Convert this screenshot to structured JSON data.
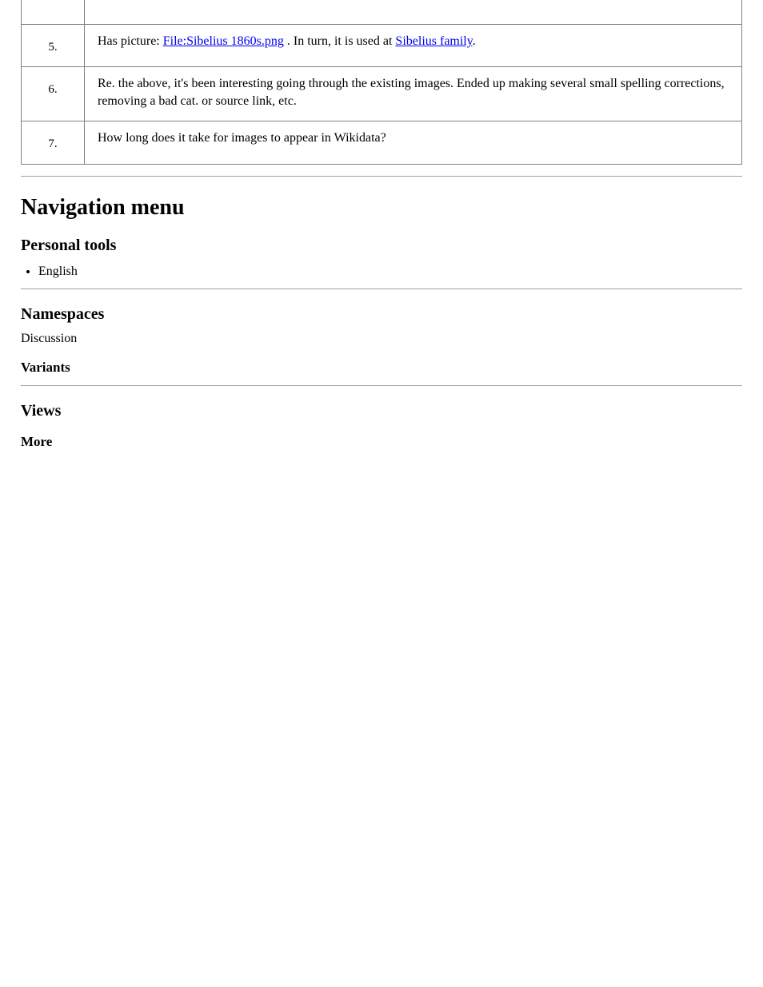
{
  "table": {
    "rows": [
      {
        "num": "5.",
        "text_before_link_a": "Has picture: ",
        "link_a": "File:Sibelius 1860s.png",
        "text_between": ". In turn, it is used at ",
        "link_b": "Sibelius family",
        "text_after": "."
      },
      {
        "num": "6.",
        "plain": "Re. the above, it's been interesting going through the existing images. Ended up making several small spelling corrections, removing a bad cat. or source link, etc."
      },
      {
        "num": "7.",
        "plain": "How long does it take for images to appear in Wikidata?"
      }
    ]
  },
  "nav_section": {
    "heading": "Navigation menu",
    "tools_heading": "Personal tools",
    "tools_items": [
      "English"
    ],
    "ns_heading": "Namespaces",
    "ns_text": "Discussion",
    "variants_heading": "Variants",
    "views_heading": "Views",
    "more_heading": "More"
  }
}
